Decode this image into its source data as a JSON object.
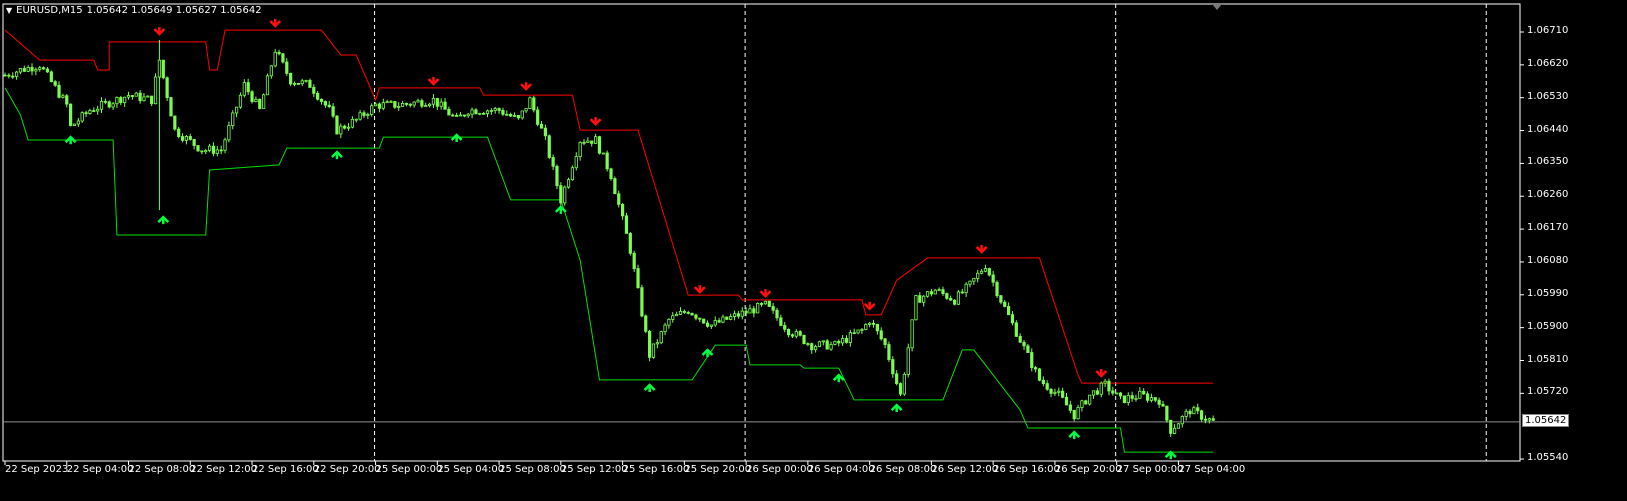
{
  "header": {
    "symbol": "EURUSD,M15",
    "ohlc": "1.05642 1.05649 1.05627 1.05642"
  },
  "bid_label": "1.05642",
  "colors": {
    "candle": "#7CFC50",
    "upper": "#FF0000",
    "lower": "#00E000",
    "arrow_down": "#FF1010",
    "arrow_up": "#00FF40",
    "grid": "#FFFFFF",
    "bid": "#909090"
  },
  "chart_data": {
    "type": "candlestick",
    "title": "EURUSD,M15",
    "x_unit": "bar index (M15)",
    "ylim": [
      1.0553,
      1.0676
    ],
    "y_ticks": [
      "1.06710",
      "1.06620",
      "1.06530",
      "1.06440",
      "1.06350",
      "1.06260",
      "1.06170",
      "1.06080",
      "1.05990",
      "1.05900",
      "1.05810",
      "1.05720",
      "1.05540"
    ],
    "x_ticks": [
      "22 Sep 2023",
      "22 Sep 04:00",
      "22 Sep 08:00",
      "22 Sep 12:00",
      "22 Sep 16:00",
      "22 Sep 20:00",
      "25 Sep 00:00",
      "25 Sep 04:00",
      "25 Sep 08:00",
      "25 Sep 12:00",
      "25 Sep 16:00",
      "25 Sep 20:00",
      "26 Sep 00:00",
      "26 Sep 04:00",
      "26 Sep 08:00",
      "26 Sep 12:00",
      "26 Sep 16:00",
      "26 Sep 20:00",
      "27 Sep 00:00",
      "27 Sep 04:00"
    ],
    "bars_per_tick": 16,
    "day_separators": [
      96,
      192,
      288,
      384
    ],
    "bid": 1.05642,
    "close_path": [
      [
        0,
        1.06592
      ],
      [
        4,
        1.06606
      ],
      [
        9,
        1.0662
      ],
      [
        16,
        1.0651
      ],
      [
        17,
        1.0645
      ],
      [
        22,
        1.06496
      ],
      [
        32,
        1.06537
      ],
      [
        38,
        1.06524
      ],
      [
        40,
        1.06633
      ],
      [
        44,
        1.06441
      ],
      [
        51,
        1.06387
      ],
      [
        56,
        1.06387
      ],
      [
        62,
        1.06565
      ],
      [
        66,
        1.06496
      ],
      [
        70,
        1.06661
      ],
      [
        74,
        1.06578
      ],
      [
        79,
        1.06565
      ],
      [
        84,
        1.06496
      ],
      [
        86,
        1.06441
      ],
      [
        91,
        1.06469
      ],
      [
        96,
        1.0651
      ],
      [
        102,
        1.0651
      ],
      [
        111,
        1.06524
      ],
      [
        117,
        1.06469
      ],
      [
        120,
        1.06496
      ],
      [
        128,
        1.06496
      ],
      [
        133,
        1.06469
      ],
      [
        136,
        1.06524
      ],
      [
        140,
        1.06414
      ],
      [
        144,
        1.0625
      ],
      [
        149,
        1.06414
      ],
      [
        153,
        1.06414
      ],
      [
        157,
        1.06318
      ],
      [
        162,
        1.06113
      ],
      [
        167,
        1.05825
      ],
      [
        172,
        1.05921
      ],
      [
        177,
        1.05948
      ],
      [
        183,
        1.05907
      ],
      [
        190,
        1.05935
      ],
      [
        197,
        1.05962
      ],
      [
        203,
        1.05893
      ],
      [
        209,
        1.05852
      ],
      [
        215,
        1.05852
      ],
      [
        222,
        1.05893
      ],
      [
        224,
        1.05921
      ],
      [
        228,
        1.05852
      ],
      [
        232,
        1.05715
      ],
      [
        236,
        1.05976
      ],
      [
        241,
        1.06003
      ],
      [
        246,
        1.05976
      ],
      [
        250,
        1.06017
      ],
      [
        254,
        1.06072
      ],
      [
        258,
        1.05976
      ],
      [
        263,
        1.05866
      ],
      [
        268,
        1.05757
      ],
      [
        273,
        1.05715
      ],
      [
        277,
        1.05661
      ],
      [
        281,
        1.05715
      ],
      [
        285,
        1.05743
      ],
      [
        289,
        1.05702
      ],
      [
        294,
        1.05715
      ],
      [
        299,
        1.05702
      ],
      [
        302,
        1.0562
      ],
      [
        307,
        1.05674
      ],
      [
        313,
        1.05642
      ]
    ],
    "spikes": [
      [
        40,
        1.06688,
        1.06222
      ]
    ],
    "upper_channel": [
      [
        0,
        1.06715
      ],
      [
        9,
        1.06633
      ],
      [
        23,
        1.06633
      ],
      [
        24,
        1.06606
      ],
      [
        27,
        1.06606
      ],
      [
        27,
        1.06683
      ],
      [
        52,
        1.06683
      ],
      [
        53,
        1.06606
      ],
      [
        55,
        1.06606
      ],
      [
        57,
        1.06715
      ],
      [
        82,
        1.06715
      ],
      [
        87,
        1.06647
      ],
      [
        91,
        1.06647
      ],
      [
        96,
        1.06524
      ],
      [
        97,
        1.06557
      ],
      [
        123,
        1.06557
      ],
      [
        124,
        1.06537
      ],
      [
        147,
        1.06537
      ],
      [
        149,
        1.06441
      ],
      [
        164,
        1.06441
      ],
      [
        177,
        1.05989
      ],
      [
        190,
        1.05989
      ],
      [
        191,
        1.05976
      ],
      [
        222,
        1.05976
      ],
      [
        223,
        1.05935
      ],
      [
        227,
        1.05935
      ],
      [
        231,
        1.0603
      ],
      [
        239,
        1.06091
      ],
      [
        268,
        1.06091
      ],
      [
        278,
        1.0577
      ],
      [
        279,
        1.05748
      ],
      [
        313,
        1.05748
      ]
    ],
    "lower_channel": [
      [
        0,
        1.06557
      ],
      [
        4,
        1.06483
      ],
      [
        6,
        1.06414
      ],
      [
        28,
        1.06414
      ],
      [
        29,
        1.06154
      ],
      [
        52,
        1.06154
      ],
      [
        53,
        1.06332
      ],
      [
        71,
        1.06346
      ],
      [
        73,
        1.06392
      ],
      [
        97,
        1.06392
      ],
      [
        98,
        1.06422
      ],
      [
        125,
        1.06422
      ],
      [
        131,
        1.0625
      ],
      [
        144,
        1.0625
      ],
      [
        149,
        1.06085
      ],
      [
        154,
        1.05757
      ],
      [
        178,
        1.05757
      ],
      [
        184,
        1.05852
      ],
      [
        192,
        1.05852
      ],
      [
        193,
        1.05798
      ],
      [
        206,
        1.05798
      ],
      [
        207,
        1.05789
      ],
      [
        216,
        1.05789
      ],
      [
        220,
        1.05702
      ],
      [
        243,
        1.05702
      ],
      [
        248,
        1.05839
      ],
      [
        251,
        1.05839
      ],
      [
        263,
        1.05674
      ],
      [
        265,
        1.05625
      ],
      [
        289,
        1.05625
      ],
      [
        290,
        1.05559
      ],
      [
        313,
        1.05559
      ]
    ],
    "sell_arrows": [
      [
        40,
        1.06688
      ],
      [
        70,
        1.0671
      ],
      [
        111,
        1.06551
      ],
      [
        135,
        1.06537
      ],
      [
        153,
        1.06441
      ],
      [
        180,
        1.05981
      ],
      [
        197,
        1.0597
      ],
      [
        224,
        1.05935
      ],
      [
        253,
        1.06091
      ],
      [
        284,
        1.05751
      ]
    ],
    "buy_arrows": [
      [
        17,
        1.06441
      ],
      [
        41,
        1.06222
      ],
      [
        86,
        1.064
      ],
      [
        117,
        1.06447
      ],
      [
        144,
        1.0625
      ],
      [
        167,
        1.05762
      ],
      [
        182,
        1.05858
      ],
      [
        216,
        1.05789
      ],
      [
        231,
        1.05707
      ],
      [
        277,
        1.05633
      ],
      [
        302,
        1.05578
      ]
    ]
  }
}
